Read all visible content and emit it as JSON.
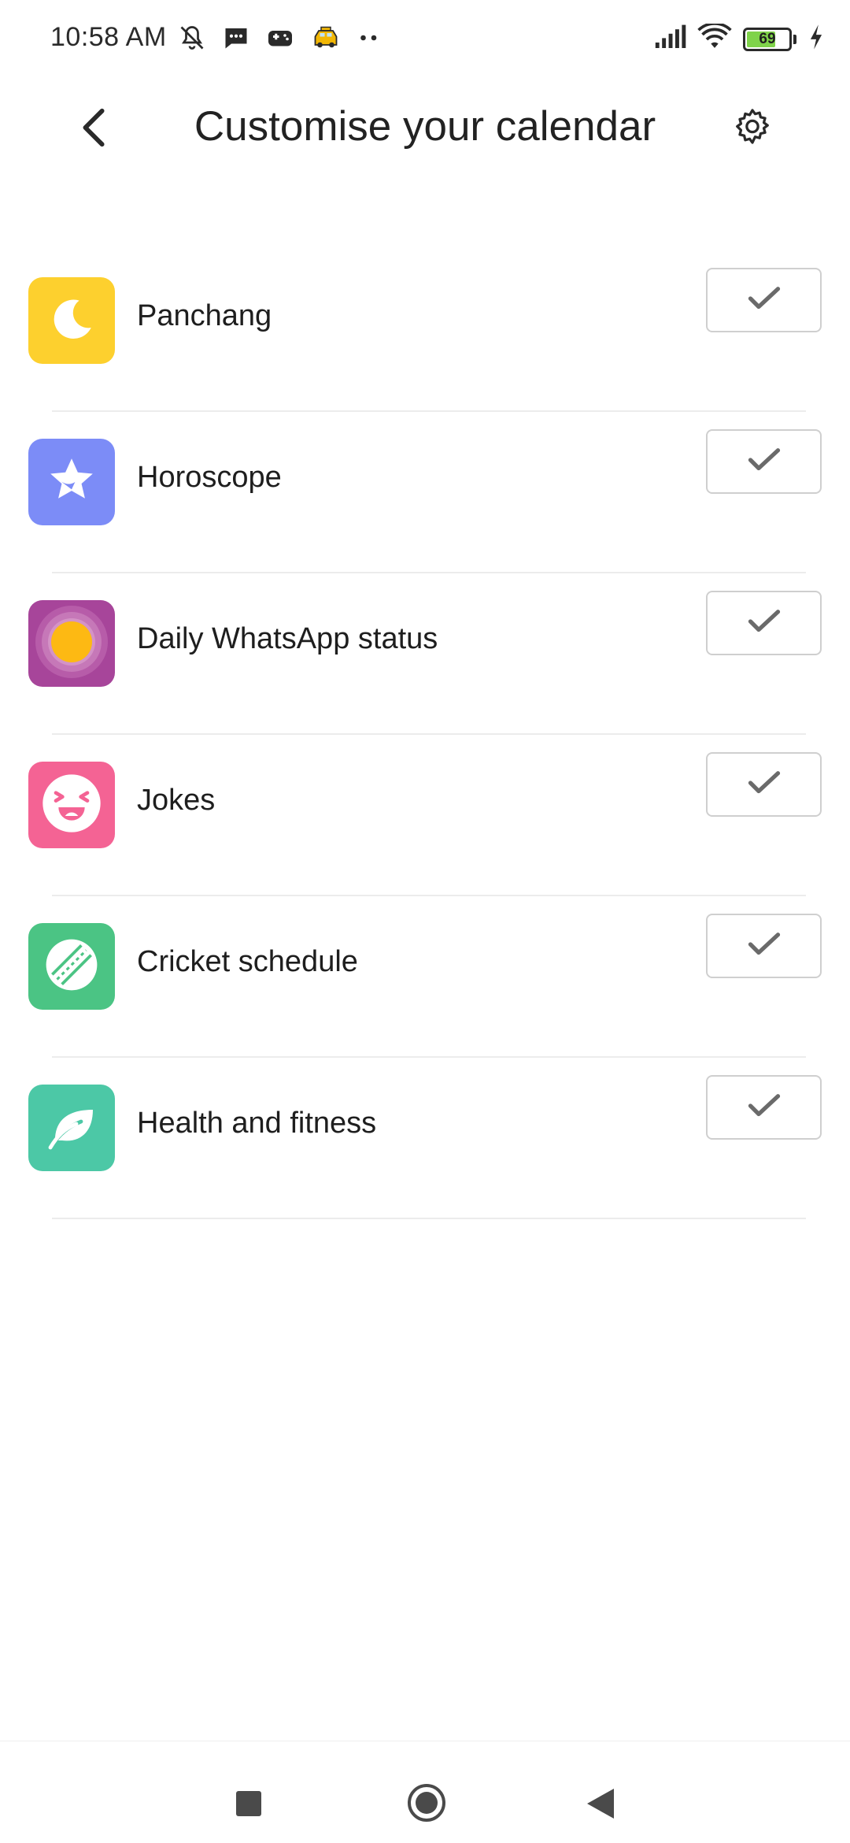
{
  "status_bar": {
    "time": "10:58 AM",
    "battery_level": "69",
    "battery_fraction": 0.69,
    "icons": [
      "bell-off-icon",
      "message-icon",
      "gamepad-icon",
      "taxi-icon",
      "more-dots-icon",
      "signal-icon",
      "wifi-icon",
      "battery-icon",
      "charging-bolt-icon"
    ]
  },
  "header": {
    "title": "Customise your calendar",
    "back_icon": "chevron-left-icon",
    "settings_icon": "gear-icon"
  },
  "items": [
    {
      "label": "Panchang",
      "icon": "moon-icon",
      "color": "#FDD02E",
      "checked": true
    },
    {
      "label": "Horoscope",
      "icon": "star-icon",
      "color": "#7C8CF7",
      "checked": true
    },
    {
      "label": "Daily WhatsApp status",
      "icon": "sun-icon",
      "color": "#A7459A",
      "checked": true
    },
    {
      "label": "Jokes",
      "icon": "laughing-face-icon",
      "color": "#F46394",
      "checked": true
    },
    {
      "label": "Cricket schedule",
      "icon": "cricket-ball-icon",
      "color": "#4BC484",
      "checked": true
    },
    {
      "label": "Health and fitness",
      "icon": "leaf-icon",
      "color": "#4CC8A6",
      "checked": true
    }
  ],
  "nav_bar": {
    "icons": [
      "recent-apps-icon",
      "home-icon",
      "back-triangle-icon"
    ]
  }
}
